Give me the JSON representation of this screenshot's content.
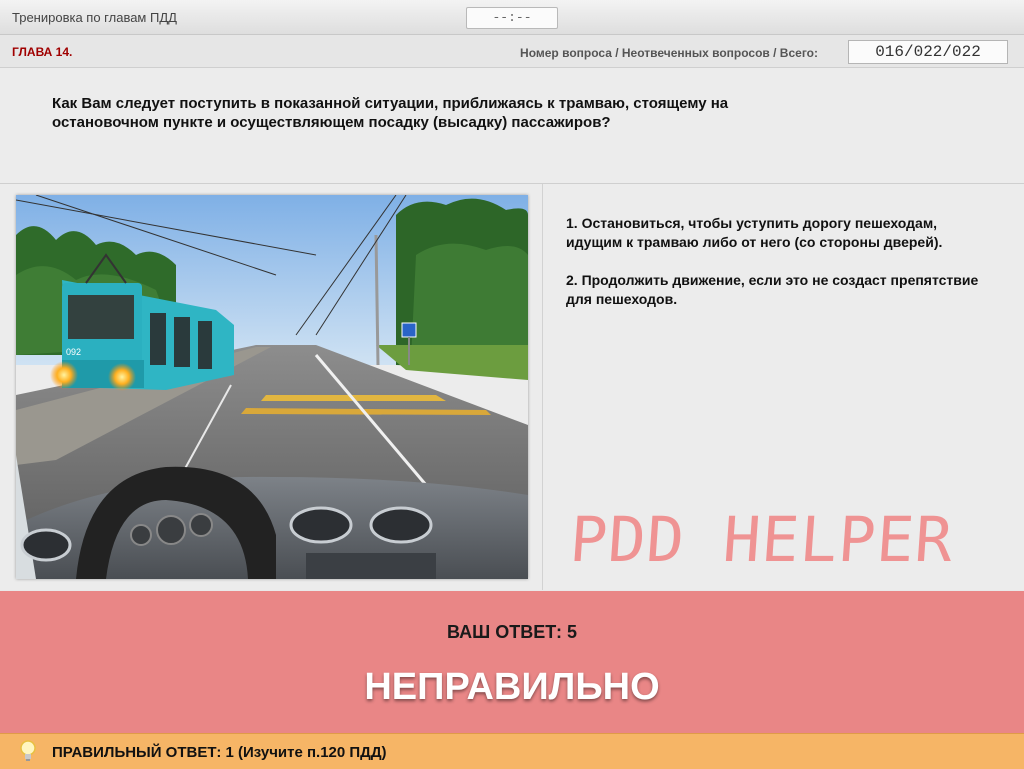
{
  "header": {
    "title": "Тренировка по главам ПДД",
    "timer": "--:--"
  },
  "chapter": {
    "label": "ГЛАВА 14.",
    "counter_label": "Номер вопроса / Неотвеченных вопросов / Всего:",
    "counter_value": "016/022/022"
  },
  "question": {
    "text": "Как Вам следует поступить в показанной ситуации, приближаясь к трамваю, стоящему на остановочном пункте и осуществляющем посадку (высадку) пассажиров?"
  },
  "answers": [
    {
      "text": "1.  Остановиться, чтобы уступить дорогу пешеходам, идущим к трамваю либо от него (со стороны дверей)."
    },
    {
      "text": "2.  Продолжить движение, если это не создаст препятствие для пешеходов."
    }
  ],
  "watermark": "PDD HELPER",
  "result": {
    "your_answer": "ВАШ  ОТВЕТ:   5",
    "verdict": "НЕПРАВИЛЬНО",
    "correct": "ПРАВИЛЬНЫЙ ОТВЕТ:   1   (Изучите п.120 ПДД)",
    "bg_color": "#e98686",
    "correct_bg_color": "#f6b566"
  },
  "photo": {
    "tram_number": "092"
  },
  "icons": {
    "bulb": "lightbulb-icon"
  }
}
